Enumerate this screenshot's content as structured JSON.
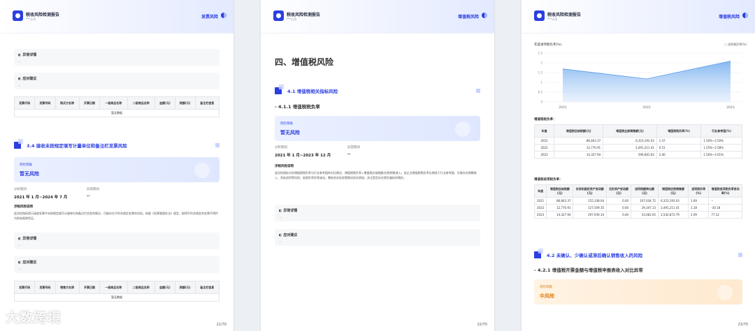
{
  "header": {
    "title": "税收风险检测报告",
    "subtitle": "***公司"
  },
  "page1": {
    "section_tag": "发票风险",
    "page_no": "21/70",
    "abnormal_label": "异常详情",
    "abnormal_value": "--",
    "action_label": "应对建议",
    "action_value": "--",
    "table1": {
      "headers": [
        "发票代码",
        "发票号码",
        "购买方名称",
        "开票日期",
        "一级商品名称",
        "二级商品名称",
        "金额(元)",
        "税额(元)",
        "备注栏信息"
      ],
      "empty": "暂无数据"
    },
    "section": "3.4  接收未按规定填写计量单位和备注栏发票风险",
    "risk_label": "风险等级",
    "risk_value": "暂无风险",
    "period_label": "分析期间",
    "period_value": "2021 年 1 月~2024 年 7 月",
    "abnormal_period_label": "异常期间",
    "abnormal_period_value": "--",
    "desc_title": "涉税风险说明",
    "desc_text": "此风险指标提示接收发票中未按规定填写计量单位和备注栏信息的情况，可能存在不符合规定发票的风险。依据《发票管理办法》规定，取得不符合规定的发票不得作为财务报销凭证。",
    "abnormal2_label": "异常详情",
    "abnormal2_value": "--",
    "action2_label": "应对建议",
    "action2_value": "--",
    "table2": {
      "headers": [
        "发票代码",
        "发票号码",
        "销售方名称",
        "开票日期",
        "一级商品名称",
        "二级商品名称",
        "金额(元)",
        "税额(元)",
        "备注栏信息"
      ],
      "empty": "暂无数据"
    }
  },
  "page2": {
    "section_tag": "增值税风险",
    "page_no": "22/70",
    "big_title": "四、增值税风险",
    "section": "4.1  增值税相关指标风险",
    "subsection": "- 4.1.1  增值税税负率",
    "risk_label": "风险等级",
    "risk_value": "暂无风险",
    "period_label": "分析期间",
    "period_value": "2021 年 1 月~2023 年 12 月",
    "abnormal_period_label": "异常期间",
    "abnormal_period_value": "--",
    "desc_title": "涉税风险说明",
    "desc_text": "此风险指标分析增值税税负率与行业参考值的对比情况，增值税税负率=增值税应纳税额/应税销售收入。若企业增值税税负率长期低于行业参考值，可能存在隐瞒收入、多抵进项等风险；若税负率异常波动，需结合实际经营情况核实原因，关注是否存在税负偏低的情形。",
    "abnormal_label": "异常详情",
    "abnormal_value": "--",
    "action_label": "应对建议",
    "action_value": "--"
  },
  "page3": {
    "section_tag": "增值税风险",
    "page_no": "23/70",
    "chart_title": "年度进项税负率(%)",
    "chart_legend": "进项税负率(%)",
    "chart_data": {
      "type": "area",
      "x": [
        "2021",
        "2022",
        "2023"
      ],
      "values": [
        1.69,
        1.18,
        2.09
      ],
      "yticks": [
        "0",
        "0.5",
        "1",
        "1.5",
        "2",
        "2.5"
      ],
      "ylim": [
        0,
        2.5
      ],
      "color": "#7fb4f0"
    },
    "table_a_label": "增值税税负率：",
    "table_a": {
      "headers": [
        "年度",
        "增值税应纳税额(元)",
        "增值税全部销售额(元)",
        "增值税税负率(%)",
        "行业参考值(%)"
      ],
      "rows": [
        [
          "2021",
          "86,843.37",
          "6,323,193.03",
          "1.37",
          "1.50%~2.50%"
        ],
        [
          "2022",
          "12,770.91",
          "2,491,211.41",
          "0.51",
          "1.55%~2.58%"
        ],
        [
          "2023",
          "14,327.94",
          "596,681.83",
          "2.40",
          "1.56%~2.61%"
        ]
      ]
    },
    "table_b_label": "增值税进项税负率：",
    "table_b": {
      "headers": [
        "年度",
        "增值税应纳税额(元)",
        "存货和固定资产变动额(元)",
        "无形资产变动额(元)",
        "进项税额转出额(元)",
        "增值税应税销售额(元)",
        "进项税负率(%)",
        "增值税进项税负率变动率(%)"
      ],
      "rows": [
        [
          "2021",
          "86,843.37",
          "155,338.04",
          "0.00",
          "107,034.72",
          "6,323,193.03",
          "1.69",
          "--"
        ],
        [
          "2022",
          "12,770.91",
          "127,509.35",
          "0.00",
          "29,347.13",
          "2,491,211.41",
          "1.18",
          "-30.18"
        ],
        [
          "2023",
          "14,327.94",
          "297,939.34",
          "0.00",
          "33,062.65",
          "2,542,873.79",
          "2.09",
          "77.12"
        ]
      ]
    },
    "section": "4.2  未确认、少确认或滞后确认销售收入的风险",
    "subsection": "- 4.2.1  增值税开票金额与增值税申报表收入对比异常",
    "risk_label": "风险等级",
    "risk_value": "中风险"
  },
  "watermark": "大数跨境"
}
